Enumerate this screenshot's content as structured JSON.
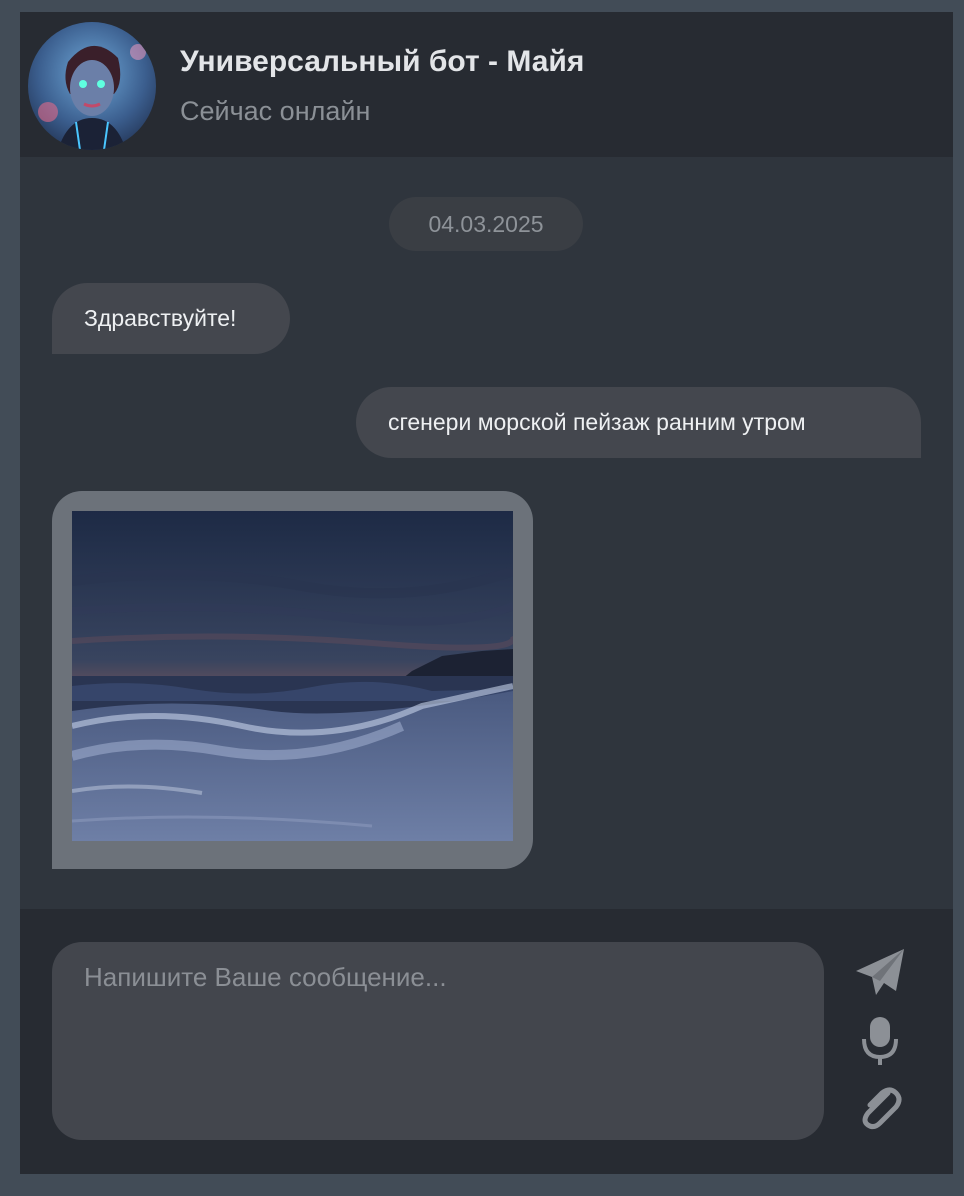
{
  "header": {
    "title": "Универсальный бот - Майя",
    "status": "Сейчас онлайн"
  },
  "chat": {
    "date": "04.03.2025",
    "messages": [
      {
        "direction": "incoming",
        "text": "Здравствуйте!"
      },
      {
        "direction": "outgoing",
        "text": "сгенери морской пейзаж ранним утром"
      },
      {
        "direction": "incoming",
        "type": "image",
        "image_subject": "seascape at dawn"
      }
    ]
  },
  "composer": {
    "placeholder": "Напишите Ваше сообщение..."
  },
  "icons": {
    "send": "send-icon",
    "mic": "microphone-icon",
    "attach": "paperclip-icon"
  },
  "colors": {
    "page_bg": "#424c57",
    "window_bg": "#2f353d",
    "header_bg": "#272b32",
    "bubble_bg": "#44474e",
    "icon_gray": "#8c9096"
  }
}
